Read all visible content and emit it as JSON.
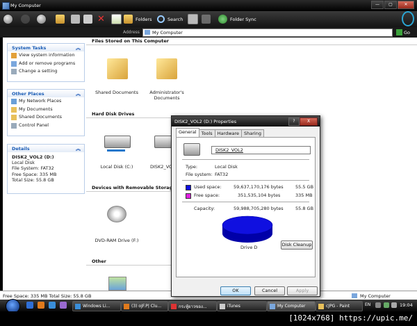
{
  "window": {
    "title": "My Computer"
  },
  "toolbar": {
    "folders": "Folders",
    "search": "Search",
    "folder_sync": "Folder Sync"
  },
  "address": {
    "label": "Address",
    "value": "My Computer",
    "go": "Go"
  },
  "system_tasks": {
    "title": "System Tasks",
    "items": [
      "View system information",
      "Add or remove programs",
      "Change a setting"
    ]
  },
  "other_places": {
    "title": "Other Places",
    "items": [
      "My Network Places",
      "My Documents",
      "Shared Documents",
      "Control Panel"
    ]
  },
  "details": {
    "title": "Details",
    "name": "DISK2_VOL2 (D:)",
    "type": "Local Disk",
    "fs": "File System: FAT32",
    "free": "Free Space: 335 MB",
    "total": "Total Size: 55.8 GB"
  },
  "sections": {
    "files": "Files Stored on This Computer",
    "hdd": "Hard Disk Drives",
    "removable": "Devices with Removable Storage",
    "other": "Other"
  },
  "items": {
    "shared_docs": "Shared Documents",
    "admin_docs_1": "Administrator's",
    "admin_docs_2": "Documents",
    "local_c": "Local Disk (C:)",
    "disk2_trunc": "DISK2_VO",
    "dvd": "DVD-RAM Drive (F:)"
  },
  "status": {
    "left": "Free Space: 335 MB Total Size: 55.8 GB",
    "right": "My Computer"
  },
  "taskbar": {
    "buttons": [
      "Windows Li...",
      "(3) oJF.P| Clu...",
      "กระทู้ยาวของ...",
      "iTunes",
      "My Computer",
      "cJPG - Paint"
    ],
    "lang": "EN",
    "clock": "19:04"
  },
  "credit": "[1024x768] https://upic.me/",
  "dialog": {
    "title": "DISK2_VOL2 (D:) Properties",
    "help": "?",
    "close": "X",
    "tabs": [
      "General",
      "Tools",
      "Hardware",
      "Sharing"
    ],
    "name_value": "DISK2_VOL2",
    "type_label": "Type:",
    "type_value": "Local Disk",
    "fs_label": "File system:",
    "fs_value": "FAT32",
    "used_label": "Used space:",
    "used_bytes": "59,637,170,176 bytes",
    "used_size": "55.5 GB",
    "free_label": "Free space:",
    "free_bytes": "351,535,104 bytes",
    "free_size": "335 MB",
    "cap_label": "Capacity:",
    "cap_bytes": "59,988,705,280 bytes",
    "cap_size": "55.8 GB",
    "drive_label": "Drive D",
    "cleanup": "Disk Cleanup",
    "ok": "OK",
    "cancel": "Cancel",
    "apply": "Apply",
    "colors": {
      "used": "#1010e0",
      "free": "#e020e0"
    },
    "used_fraction": 0.994
  }
}
